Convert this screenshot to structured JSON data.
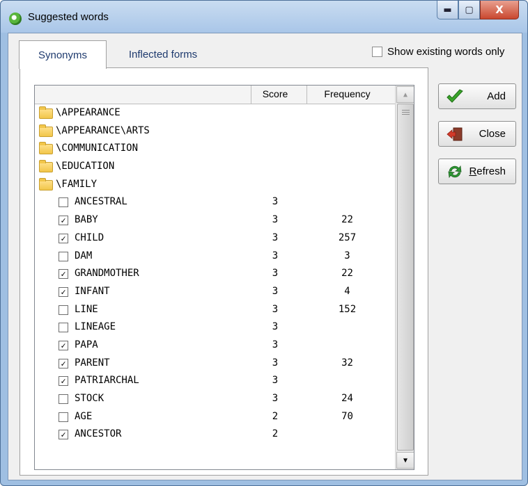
{
  "window": {
    "title": "Suggested words",
    "controls": {
      "minimize": "▬",
      "maximize": "▢",
      "close": "X"
    }
  },
  "tabs": [
    {
      "label": "Synonyms",
      "active": true
    },
    {
      "label": "Inflected forms",
      "active": false
    }
  ],
  "show_existing": {
    "label": "Show existing words only",
    "checked": false
  },
  "list": {
    "columns": [
      "",
      "Score",
      "Frequency"
    ],
    "folders": [
      "\\APPEARANCE",
      "\\APPEARANCE\\ARTS",
      "\\COMMUNICATION",
      "\\EDUCATION",
      "\\FAMILY"
    ],
    "words": [
      {
        "checked": false,
        "word": "ANCESTRAL",
        "score": "3",
        "freq": ""
      },
      {
        "checked": true,
        "word": "BABY",
        "score": "3",
        "freq": "22"
      },
      {
        "checked": true,
        "word": "CHILD",
        "score": "3",
        "freq": "257"
      },
      {
        "checked": false,
        "word": "DAM",
        "score": "3",
        "freq": "3"
      },
      {
        "checked": true,
        "word": "GRANDMOTHER",
        "score": "3",
        "freq": "22"
      },
      {
        "checked": true,
        "word": "INFANT",
        "score": "3",
        "freq": "4"
      },
      {
        "checked": false,
        "word": "LINE",
        "score": "3",
        "freq": "152"
      },
      {
        "checked": false,
        "word": "LINEAGE",
        "score": "3",
        "freq": ""
      },
      {
        "checked": true,
        "word": "PAPA",
        "score": "3",
        "freq": ""
      },
      {
        "checked": true,
        "word": "PARENT",
        "score": "3",
        "freq": "32"
      },
      {
        "checked": true,
        "word": "PATRIARCHAL",
        "score": "3",
        "freq": ""
      },
      {
        "checked": false,
        "word": "STOCK",
        "score": "3",
        "freq": "24"
      },
      {
        "checked": false,
        "word": "AGE",
        "score": "2",
        "freq": "70"
      },
      {
        "checked": true,
        "word": "ANCESTOR",
        "score": "2",
        "freq": ""
      }
    ],
    "check_mark": "✓"
  },
  "buttons": {
    "add": {
      "label": "Add",
      "icon": "checkmark-icon",
      "color": "#3aa52a"
    },
    "close": {
      "label": "Close",
      "icon": "exit-door-icon",
      "color": "#d23a2a"
    },
    "refresh": {
      "label": "Refresh",
      "icon": "refresh-icon",
      "color": "#2e9a34"
    }
  }
}
